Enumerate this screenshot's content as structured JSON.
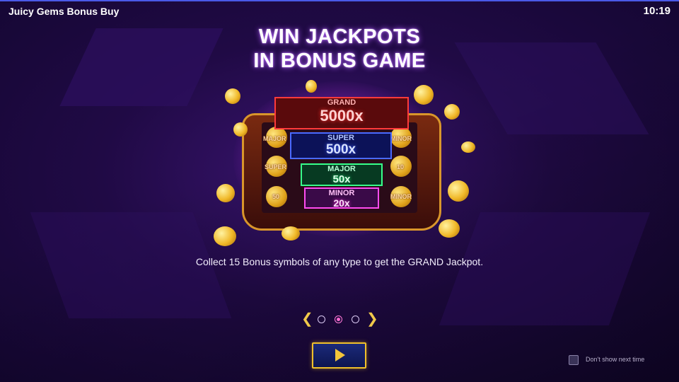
{
  "app": {
    "title": "Juicy Gems Bonus Buy",
    "clock": "10:19"
  },
  "headline": {
    "line1": "WIN JACKPOTS",
    "line2": "IN BONUS GAME"
  },
  "jackpots": [
    {
      "name": "GRAND",
      "value": "5000x"
    },
    {
      "name": "SUPER",
      "value": "500x"
    },
    {
      "name": "MAJOR",
      "value": "50x"
    },
    {
      "name": "MINOR",
      "value": "20x"
    }
  ],
  "reel_symbols": {
    "left": [
      "MAJOR",
      "SUPER",
      "50"
    ],
    "right": [
      "MINOR",
      "10",
      "MINOR"
    ]
  },
  "caption": "Collect 15 Bonus symbols of any type to get the GRAND Jackpot.",
  "pager": {
    "prev_icon": "chevron-left-icon",
    "next_icon": "chevron-right-icon",
    "pages": 3,
    "current": 2
  },
  "play_button": {
    "icon": "play-icon"
  },
  "dont_show": {
    "label": "Don't show next time",
    "checked": false
  },
  "colors": {
    "accent_gold": "#f0c02a",
    "grand": "#ff3b3b",
    "super": "#4a6aff",
    "major": "#37ff8a",
    "minor": "#ff4cf0",
    "background": "#200a45"
  }
}
